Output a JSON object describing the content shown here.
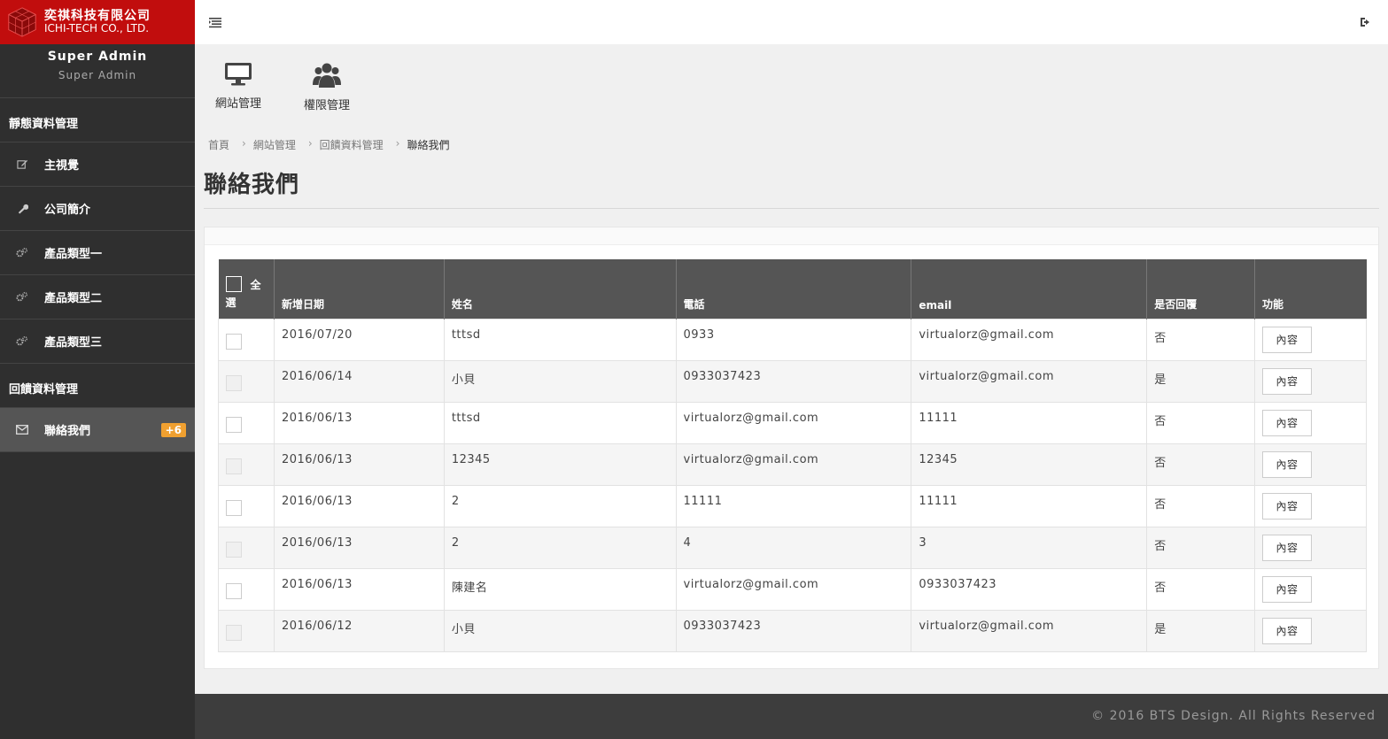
{
  "brand": {
    "name_cn": "奕祺科技有限公司",
    "name_en": "ICHI-TECH CO., LTD."
  },
  "profile": {
    "name": "Super Admin",
    "role": "Super Admin"
  },
  "sidebar": {
    "section1": "靜態資料管理",
    "items1": [
      {
        "label": "主視覺",
        "icon": "edit-icon"
      },
      {
        "label": "公司簡介",
        "icon": "wrench-icon"
      },
      {
        "label": "產品類型一",
        "icon": "gears-icon"
      },
      {
        "label": "產品類型二",
        "icon": "gears-icon"
      },
      {
        "label": "產品類型三",
        "icon": "gears-icon"
      }
    ],
    "section2": "回饋資料管理",
    "items2": [
      {
        "label": "聯絡我們",
        "icon": "envelope-icon",
        "badge": "+6"
      }
    ]
  },
  "shortcuts": [
    {
      "label": "網站管理",
      "icon": "monitor-icon"
    },
    {
      "label": "權限管理",
      "icon": "users-icon"
    }
  ],
  "breadcrumb": [
    "首頁",
    "網站管理",
    "回饋資料管理",
    "聯絡我們"
  ],
  "page_title": "聯絡我們",
  "table": {
    "select_all": "全選",
    "headers": [
      "新增日期",
      "姓名",
      "電話",
      "email",
      "是否回覆",
      "功能"
    ],
    "action_label": "內容",
    "rows": [
      {
        "date": "2016/07/20",
        "name": "tttsd",
        "phone": "0933",
        "email": "virtualorz@gmail.com",
        "replied": "否"
      },
      {
        "date": "2016/06/14",
        "name": "小貝",
        "phone": "0933037423",
        "email": "virtualorz@gmail.com",
        "replied": "是"
      },
      {
        "date": "2016/06/13",
        "name": "tttsd",
        "phone": "virtualorz@gmail.com",
        "email": "11111",
        "replied": "否"
      },
      {
        "date": "2016/06/13",
        "name": "12345",
        "phone": "virtualorz@gmail.com",
        "email": "12345",
        "replied": "否"
      },
      {
        "date": "2016/06/13",
        "name": "2",
        "phone": "11111",
        "email": "11111",
        "replied": "否"
      },
      {
        "date": "2016/06/13",
        "name": "2",
        "phone": "4",
        "email": "3",
        "replied": "否"
      },
      {
        "date": "2016/06/13",
        "name": "陳建名",
        "phone": "virtualorz@gmail.com",
        "email": "0933037423",
        "replied": "否"
      },
      {
        "date": "2016/06/12",
        "name": "小貝",
        "phone": "0933037423",
        "email": "virtualorz@gmail.com",
        "replied": "是"
      }
    ]
  },
  "footer": {
    "copyright": "© 2016 BTS Design. All Rights Reserved"
  },
  "colors": {
    "brand_red": "#c10d0d",
    "sidebar_bg": "#2f2f2f",
    "badge": "#f0a030",
    "table_head": "#555555"
  }
}
